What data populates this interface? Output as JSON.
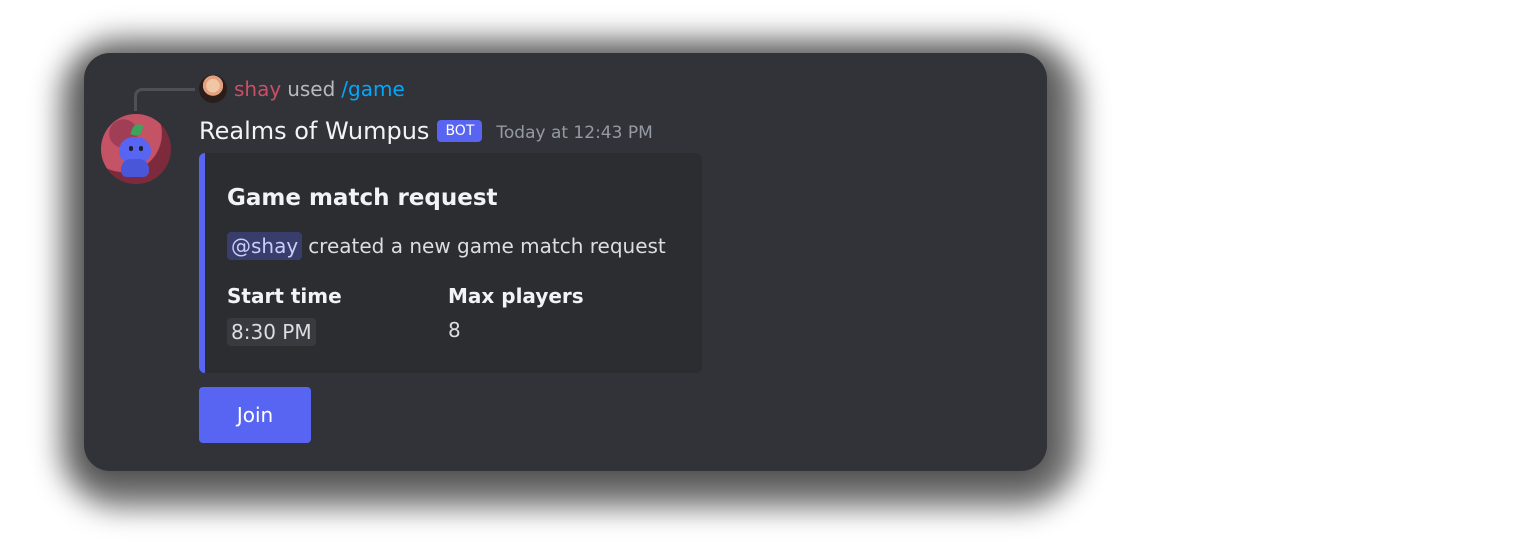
{
  "reply": {
    "username": "shay",
    "action": "used",
    "command": "/game"
  },
  "message": {
    "author": "Realms of Wumpus",
    "tag": "BOT",
    "timestamp": "Today at 12:43 PM"
  },
  "embed": {
    "title": "Game match request",
    "mention": "@shay",
    "description": "created a new game match request",
    "fields": [
      {
        "name": "Start time",
        "value": "8:30 PM"
      },
      {
        "name": "Max players",
        "value": "8"
      }
    ],
    "accent_color": "#5865f2"
  },
  "button": {
    "label": "Join"
  },
  "colors": {
    "background": "#313338",
    "embed_background": "#2b2d31",
    "button": "#5865f2",
    "username": "#c94f67",
    "command": "#00a8fc"
  },
  "icons": {
    "reply_avatar": "user-avatar-icon",
    "bot_avatar": "wumpus-avatar-icon"
  }
}
